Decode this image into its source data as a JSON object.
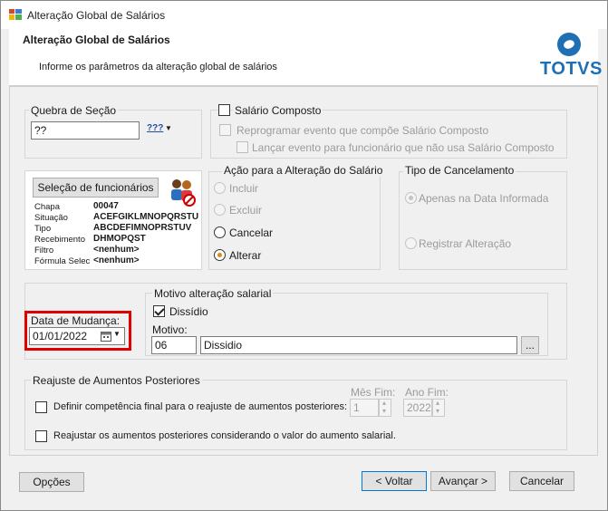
{
  "window": {
    "title": "Alteração Global de Salários"
  },
  "header": {
    "title": "Alteração Global de Salários",
    "subtitle": "Informe os parâmetros da alteração global de salários",
    "logo_text": "TOTVS",
    "logo_color": "#1f6fb5"
  },
  "quebra_secao": {
    "label": "Quebra de Seção",
    "value": "??",
    "filter_button": "???"
  },
  "salario_composto": {
    "label": "Salário Composto",
    "reprogramar_label": "Reprogramar evento que compõe Salário Composto",
    "lancar_label": "Lançar evento para funcionário que não usa Salário Composto"
  },
  "selecao": {
    "button_label": "Seleção de funcionários",
    "fields": [
      {
        "label": "Chapa",
        "value": "00047"
      },
      {
        "label": "Situação",
        "value": "ACEFGIKLMNOPQRSTU"
      },
      {
        "label": "Tipo",
        "value": "ABCDEFIMNOPRSTUV"
      },
      {
        "label": "Recebimento",
        "value": "DHMOPQST"
      },
      {
        "label": "Filtro",
        "value": "<nenhum>"
      },
      {
        "label": "Fórmula Selec",
        "value": "<nenhum>"
      }
    ]
  },
  "acao": {
    "label": "Ação para a Alteração do Salário",
    "options": [
      "Incluir",
      "Excluir",
      "Cancelar",
      "Alterar"
    ]
  },
  "tipo_cancelamento": {
    "label": "Tipo de Cancelamento",
    "options": [
      "Apenas na Data Informada",
      "Registrar Alteração"
    ]
  },
  "data_mudanca": {
    "label": "Data de Mudança:",
    "value": "01/01/2022",
    "highlight_color": "#e00000"
  },
  "motivo": {
    "group_label": "Motivo alteração salarial",
    "dissidio_label": "Dissídio",
    "motivo_label": "Motivo:",
    "code": "06",
    "description": "Dissidio",
    "browse_button": "..."
  },
  "reajuste": {
    "label": "Reajuste de Aumentos Posteriores",
    "definir_label": "Definir competência final para o reajuste de aumentos posteriores:",
    "mes_fim_label": "Mês Fim:",
    "mes_fim_value": "1",
    "ano_fim_label": "Ano Fim:",
    "ano_fim_value": "2022",
    "reajustar_label": "Reajustar os aumentos posteriores considerando o valor do aumento salarial."
  },
  "footer": {
    "options_button": "Opções",
    "back_button": "< Voltar",
    "next_button": "Avançar >",
    "cancel_button": "Cancelar"
  }
}
